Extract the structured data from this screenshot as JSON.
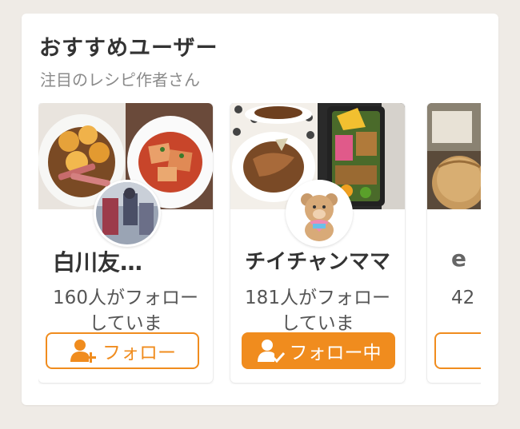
{
  "section": {
    "title": "おすすめユーザー",
    "subtitle": "注目のレシピ作者さん"
  },
  "colors": {
    "accent": "#f08c1e",
    "background": "#efebe6"
  },
  "cards": [
    {
      "name": "白川友…",
      "followers": "160人がフォローしていま",
      "button_label": "フォロー",
      "button_state": "follow",
      "button_icon": "add-user-icon"
    },
    {
      "name": "チイチャンママ",
      "followers": "181人がフォローしていま",
      "button_label": "フォロー中",
      "button_state": "following",
      "button_icon": "user-check-icon"
    },
    {
      "name": "e",
      "followers": "42",
      "button_label": "",
      "button_state": "follow",
      "button_icon": "add-user-icon"
    }
  ]
}
